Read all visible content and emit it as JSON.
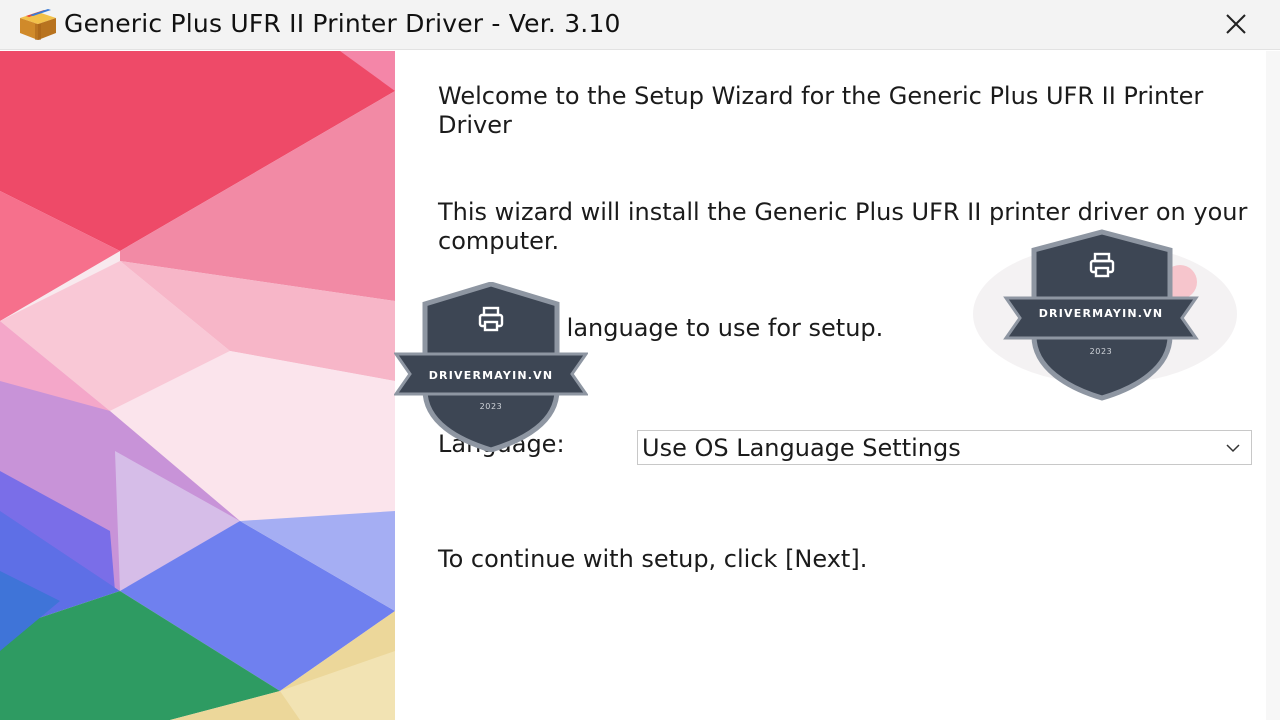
{
  "window": {
    "title": "Generic Plus UFR II Printer Driver - Ver. 3.10",
    "app_icon": "package-box-icon",
    "close_icon": "close-icon"
  },
  "content": {
    "welcome_text": "Welcome to the Setup Wizard for the Generic Plus UFR II Printer Driver",
    "install_text": "This wizard will install the Generic Plus UFR II printer driver on your computer.",
    "select_language_text": "Select the language to use for setup.",
    "language_label": "Language:",
    "language_value": "Use OS Language Settings",
    "continue_text": "To continue with setup, click [Next]."
  },
  "watermark": {
    "brand": "DRIVERMAYIN.VN",
    "year": "2023",
    "icon": "printer-icon"
  },
  "colors": {
    "shield": "#3d4654",
    "shield_border": "#8e96a2",
    "side_pink": "#ef4a6b",
    "side_blue": "#6a78ee",
    "side_green": "#2f9a5a"
  }
}
